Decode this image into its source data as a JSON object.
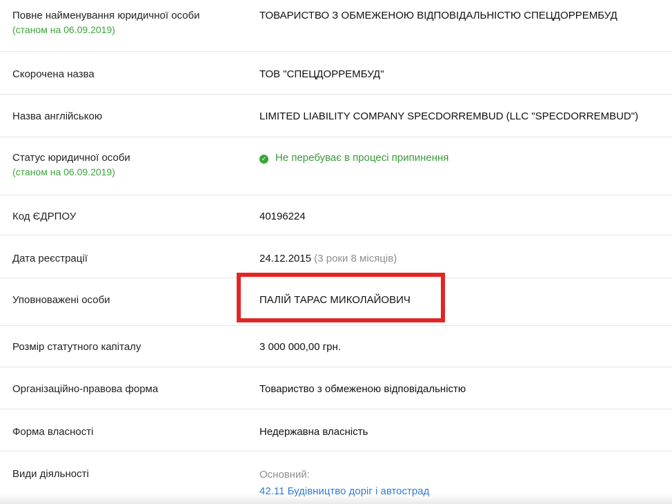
{
  "rows": [
    {
      "label": "Повне найменування юридичної особи",
      "sublabel": "(станом на 06.09.2019)",
      "value": "ТОВАРИСТВО З ОБМЕЖЕНОЮ ВІДПОВІДАЛЬНІСТЮ СПЕЦДОРРЕМБУД"
    },
    {
      "label": "Скорочена назва",
      "value": "ТОВ \"СПЕЦДОРРЕМБУД\""
    },
    {
      "label": "Назва англійською",
      "value": "LIMITED LIABILITY COMPANY SPECDORREMBUD (LLC \"SPECDORREMBUD\")"
    },
    {
      "label": "Статус юридичної особи",
      "sublabel": "(станом на 06.09.2019)",
      "value": "Не перебуває в процесі припинення",
      "icon": "check-circle-icon",
      "value_color": "#3a9a38"
    },
    {
      "label": "Код ЄДРПОУ",
      "value": "40196224"
    },
    {
      "label": "Дата реєстрації",
      "value": "24.12.2015",
      "value_extra": "(3 роки 8 місяців)"
    },
    {
      "label": "Уповноважені особи",
      "value": "ПАЛІЙ ТАРАС МИКОЛАЙОВИЧ",
      "highlight_color": "#e22624"
    },
    {
      "label": "Розмір статутного капіталу",
      "value": "3 000 000,00 грн."
    },
    {
      "label": "Організаційно-правова форма",
      "value": "Товариство з обмеженою відповідальністю"
    },
    {
      "label": "Форма власності",
      "value": "Недержавна власність"
    },
    {
      "label": "Види діяльності",
      "value": "Основний:",
      "value_link": "42.11 Будівництво доріг і автострад"
    }
  ],
  "colors": {
    "accent_green": "#3aa538",
    "link_blue": "#2f7bd6",
    "highlight_red": "#e22624"
  }
}
